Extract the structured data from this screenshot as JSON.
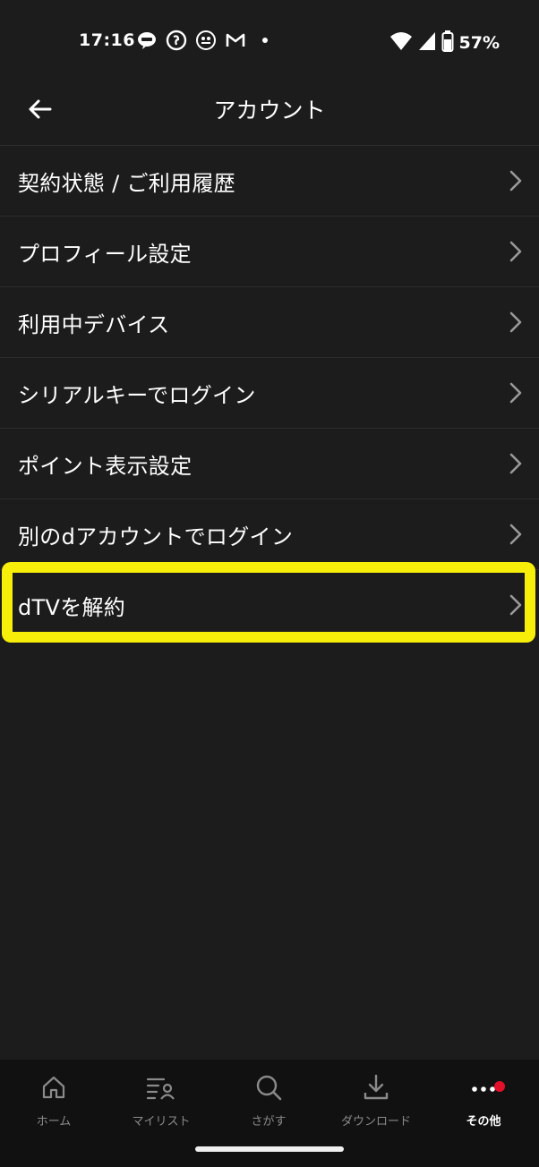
{
  "status_bar": {
    "time": "17:16",
    "battery_percent": "57%",
    "notification_icons": [
      "line-icon",
      "fan-icon",
      "asoview-icon",
      "gmail-icon",
      "dot-icon"
    ]
  },
  "app_bar": {
    "title": "アカウント"
  },
  "menu": {
    "items": [
      {
        "label": "契約状態 / ご利用履歴"
      },
      {
        "label": "プロフィール設定"
      },
      {
        "label": "利用中デバイス"
      },
      {
        "label": "シリアルキーでログイン"
      },
      {
        "label": "ポイント表示設定"
      },
      {
        "label": "別のdアカウントでログイン"
      },
      {
        "label": "dTVを解約"
      }
    ]
  },
  "highlight": {
    "color": "#f7ef0a",
    "target": "dTVを解約"
  },
  "bottom_nav": {
    "items": [
      {
        "label": "ホーム",
        "icon": "home-icon"
      },
      {
        "label": "マイリスト",
        "icon": "mylist-icon"
      },
      {
        "label": "さがす",
        "icon": "search-icon"
      },
      {
        "label": "ダウンロード",
        "icon": "download-icon"
      },
      {
        "label": "その他",
        "icon": "more-icon",
        "active": true
      }
    ],
    "badge_color": "#e3102a"
  },
  "colors": {
    "background": "#1c1c1c",
    "text": "#ffffff",
    "nav_background": "#111111",
    "inactive_label": "#8a8a8a"
  }
}
